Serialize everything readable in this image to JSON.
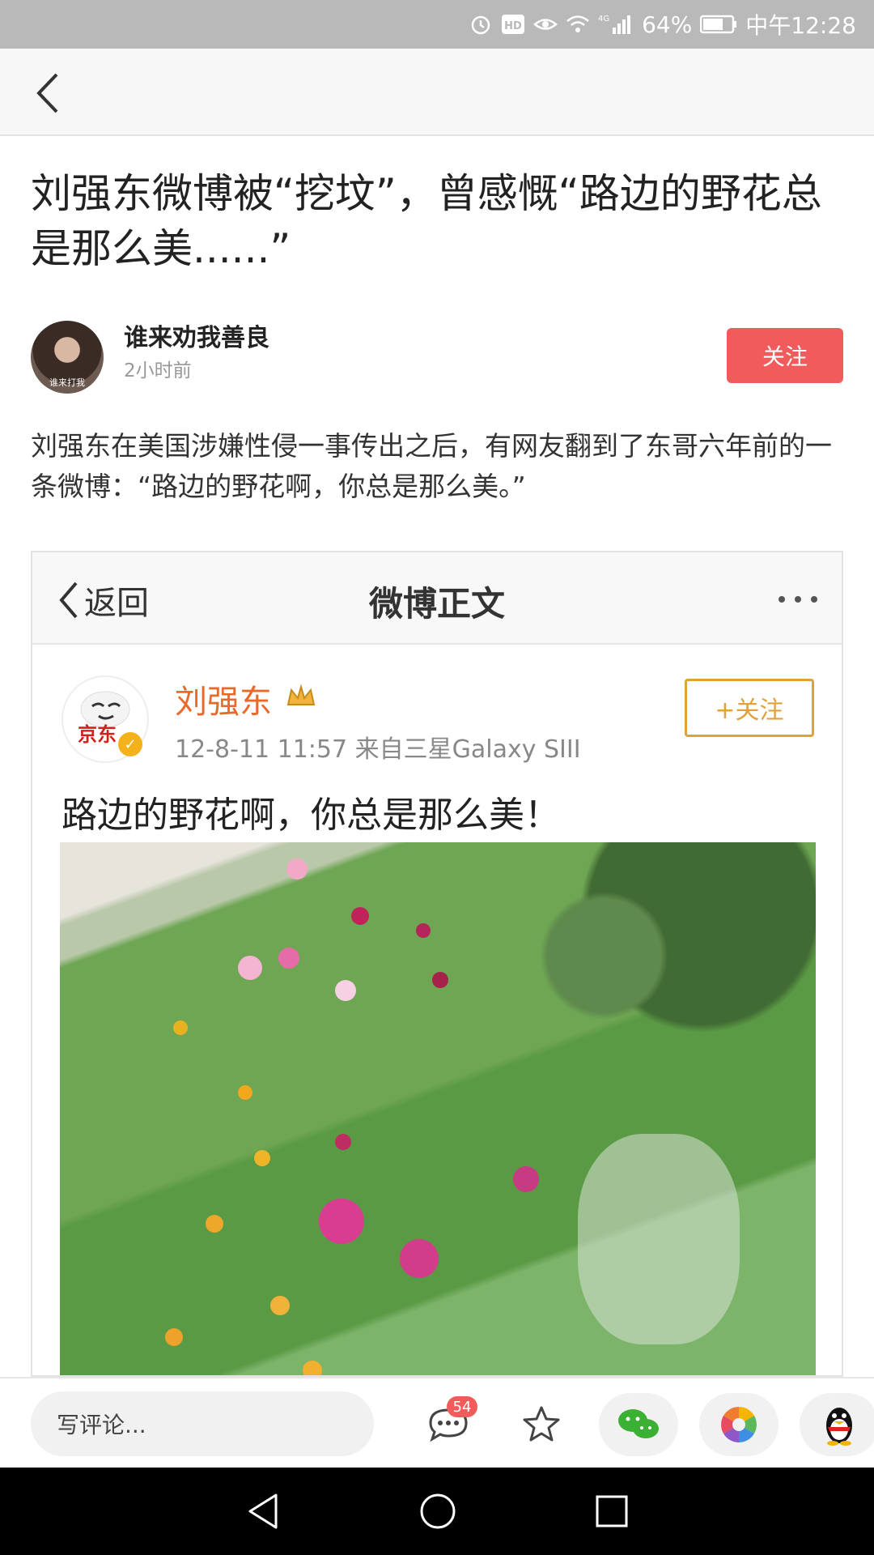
{
  "status_bar": {
    "signal_label": "4G",
    "battery": "64%",
    "time": "中午12:28"
  },
  "article": {
    "title": "刘强东微博被“挖坟”，曾感慨“路边的野花总是那么美......”",
    "author": {
      "name": "谁来劝我善良",
      "time": "2小时前",
      "avatar_caption": "谁来打我"
    },
    "follow_label": "关注",
    "body": "刘强东在美国涉嫌性侵一事传出之后，有网友翻到了东哥六年前的一条微博：“路边的野花啊，你总是那么美。”"
  },
  "embedded_screenshot": {
    "nav": {
      "back_label": "返回",
      "title": "微博正文"
    },
    "post": {
      "name": "刘强东",
      "avatar_logo": "京东",
      "meta": "12-8-11 11:57  来自三星Galaxy SIII",
      "follow_label": "+关注",
      "text": "路边的野花啊，你总是那么美！"
    }
  },
  "bottom_bar": {
    "comment_placeholder": "写评论...",
    "comment_count": "54"
  },
  "colors": {
    "accent": "#f25b5b",
    "weibo_name": "#e86a2a",
    "weibo_follow": "#e0a13a"
  }
}
